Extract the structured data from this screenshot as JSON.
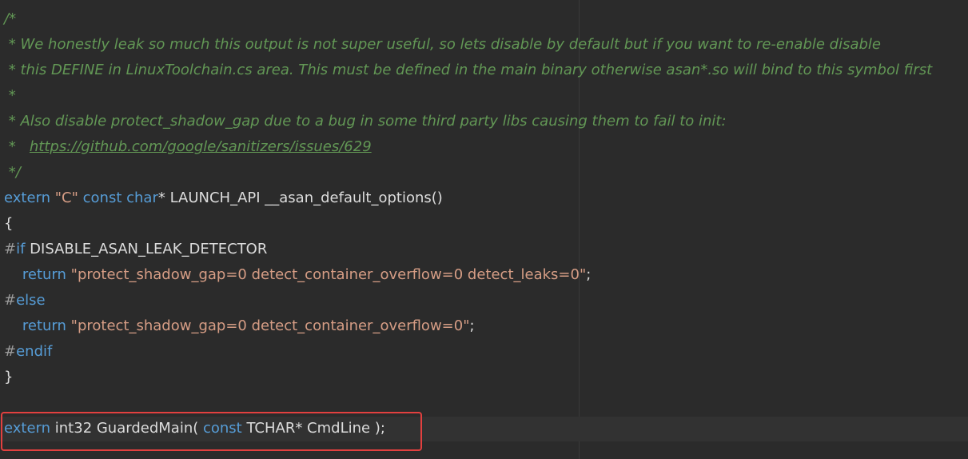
{
  "comment": {
    "open": "/*",
    "line1": " * We honestly leak so much this output is not super useful, so lets disable by default but if you want to re-enable disable",
    "line2": " * this DEFINE in LinuxToolchain.cs area. This must be defined in the main binary otherwise asan*.so will bind to this symbol first",
    "line3": " *",
    "line4": " * Also disable protect_shadow_gap due to a bug in some third party libs causing them to fail to init:",
    "line5_prefix": " *   ",
    "link": "https://github.com/google/sanitizers/issues/629",
    "close": " */"
  },
  "decl": {
    "extern": "extern",
    "c_str": " \"C\"",
    "const": " const",
    "char": " char",
    "rest": "* LAUNCH_API __asan_default_options()"
  },
  "brace_open": "{",
  "pp_if": {
    "hash": "#",
    "if": "if",
    "name": " DISABLE_ASAN_LEAK_DETECTOR"
  },
  "ret1": {
    "indent": "    ",
    "kw": "return",
    "str": " \"protect_shadow_gap=0 detect_container_overflow=0 detect_leaks=0\"",
    "semi": ";"
  },
  "pp_else": {
    "hash": "#",
    "else": "else"
  },
  "ret2": {
    "indent": "    ",
    "kw": "return",
    "str": " \"protect_shadow_gap=0 detect_container_overflow=0\"",
    "semi": ";"
  },
  "pp_endif": {
    "hash": "#",
    "endif": "endif"
  },
  "brace_close": "}",
  "guarded": {
    "extern": "extern",
    "pre": " int32 GuardedMain( ",
    "const": "const",
    "post": " TCHAR* CmdLine );"
  },
  "colors": {
    "background": "#2b2b2b",
    "comment": "#629755",
    "keyword": "#569cd6",
    "string": "#d69d85",
    "highlight_box": "#e2403f"
  }
}
